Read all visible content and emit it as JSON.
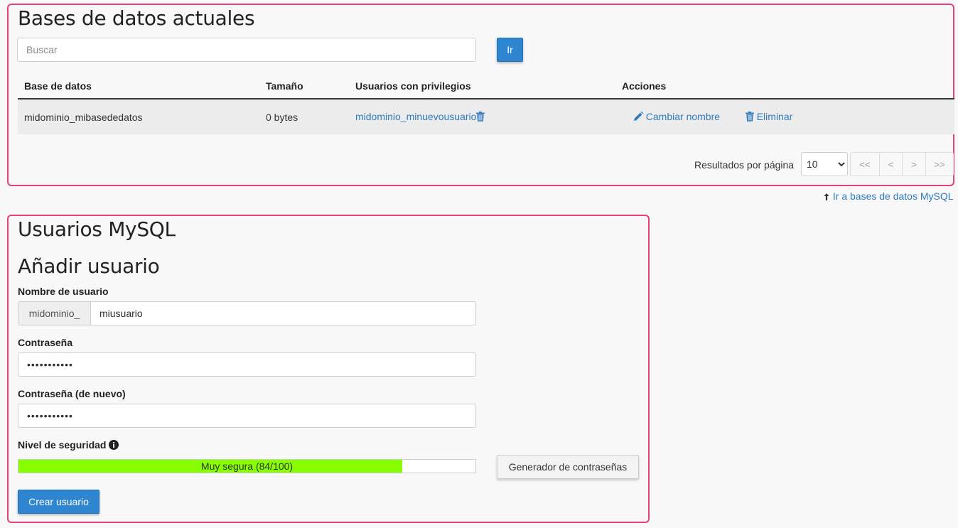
{
  "databases": {
    "title": "Bases de datos actuales",
    "search_placeholder": "Buscar",
    "search_value": "",
    "go_button": "Ir",
    "columns": [
      "Base de datos",
      "Tamaño",
      "Usuarios con privilegios",
      "Acciones"
    ],
    "rows": [
      {
        "name": "midominio_mibasededatos",
        "size": "0 bytes",
        "user": "midominio_minuevousuario",
        "rename": "Cambiar nombre",
        "delete": "Eliminar"
      }
    ],
    "pagination": {
      "label": "Resultados por página",
      "per_page": "10",
      "first": "<<",
      "prev": "<",
      "next": ">",
      "last": ">>"
    },
    "goto_link": "Ir a bases de datos MySQL"
  },
  "users": {
    "title": "Usuarios MySQL",
    "add_title": "Añadir usuario",
    "username_label": "Nombre de usuario",
    "username_prefix": "midominio_",
    "username_value": "miusuario",
    "password_label": "Contraseña",
    "password_value": "•••••••••••",
    "password2_label": "Contraseña (de nuevo)",
    "password2_value": "•••••••••••",
    "strength_label": "Nivel de seguridad",
    "strength_text": "Muy segura (84/100)",
    "strength_percent": 84,
    "generator_button": "Generador de contraseñas",
    "create_button": "Crear usuario"
  },
  "colors": {
    "accent": "#2e86d0",
    "panel_border": "#e8417a",
    "strength_fill": "#87ff00",
    "link": "#2e7bbf"
  },
  "icons": {
    "user_delete": "trash-icon",
    "rename": "pencil-icon",
    "delete": "trash-icon",
    "info": "info-icon",
    "up_arrow": "arrow-up-icon"
  }
}
